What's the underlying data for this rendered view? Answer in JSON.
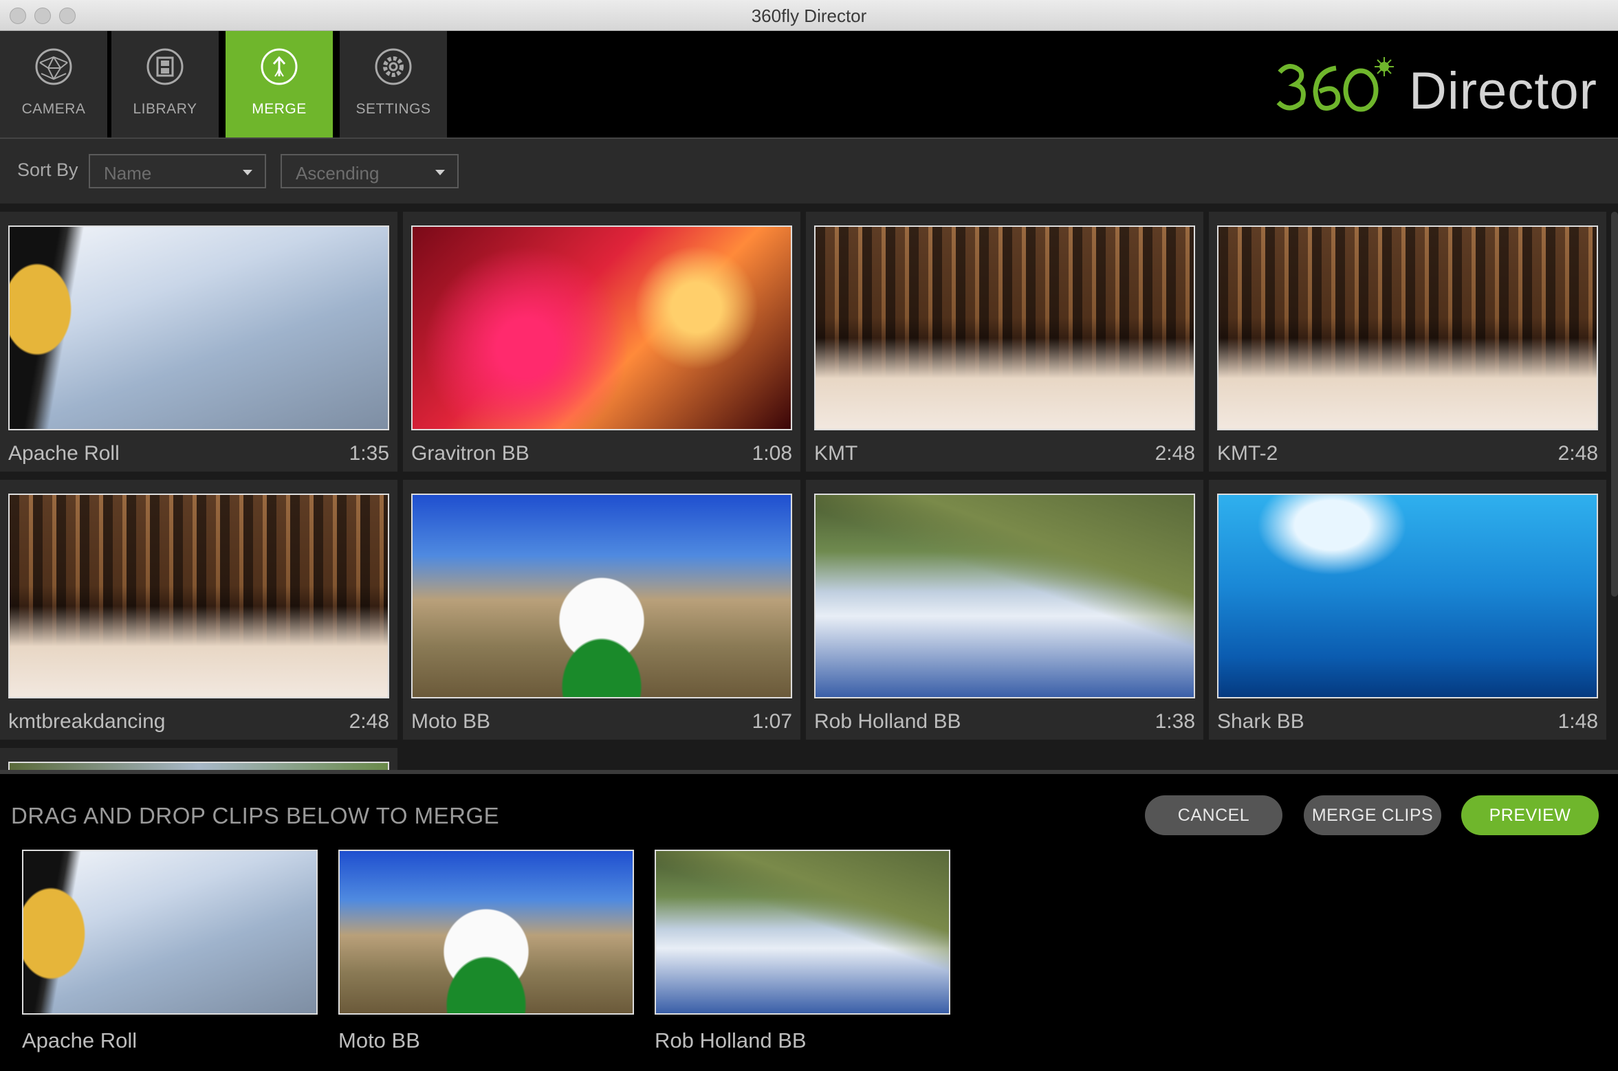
{
  "window": {
    "title": "360fly Director"
  },
  "nav": {
    "tabs": [
      {
        "label": "CAMERA",
        "icon": "camera-globe-icon",
        "active": false
      },
      {
        "label": "LIBRARY",
        "icon": "film-icon",
        "active": false
      },
      {
        "label": "MERGE",
        "icon": "merge-arrow-icon",
        "active": true
      },
      {
        "label": "SETTINGS",
        "icon": "gear-icon",
        "active": false
      }
    ],
    "logo_text": "Director",
    "logo_number": "360"
  },
  "sort": {
    "label": "Sort By",
    "field_value": "Name",
    "order_value": "Ascending"
  },
  "library": {
    "clips": [
      {
        "name": "Apache Roll",
        "duration": "1:35",
        "scene": "t-apache"
      },
      {
        "name": "Gravitron BB",
        "duration": "1:08",
        "scene": "t-gravitron"
      },
      {
        "name": "KMT",
        "duration": "2:48",
        "scene": "t-kmt"
      },
      {
        "name": "KMT-2",
        "duration": "2:48",
        "scene": "t-kmt"
      },
      {
        "name": "kmtbreakdancing",
        "duration": "2:48",
        "scene": "t-kmt"
      },
      {
        "name": "Moto BB",
        "duration": "1:07",
        "scene": "t-moto"
      },
      {
        "name": "Rob Holland BB",
        "duration": "1:38",
        "scene": "t-rob"
      },
      {
        "name": "Shark BB",
        "duration": "1:48",
        "scene": "t-shark"
      }
    ]
  },
  "merge": {
    "heading": "DRAG AND DROP CLIPS BELOW TO MERGE",
    "cancel_label": "CANCEL",
    "merge_label": "MERGE CLIPS",
    "preview_label": "PREVIEW",
    "clips": [
      {
        "name": "Apache Roll",
        "scene": "t-apache"
      },
      {
        "name": "Moto BB",
        "scene": "t-moto"
      },
      {
        "name": "Rob Holland BB",
        "scene": "t-rob"
      }
    ]
  },
  "colors": {
    "accent": "#6fb62c",
    "nav_bg": "#2c2c2c",
    "panel_bg": "#2a2a2a"
  }
}
